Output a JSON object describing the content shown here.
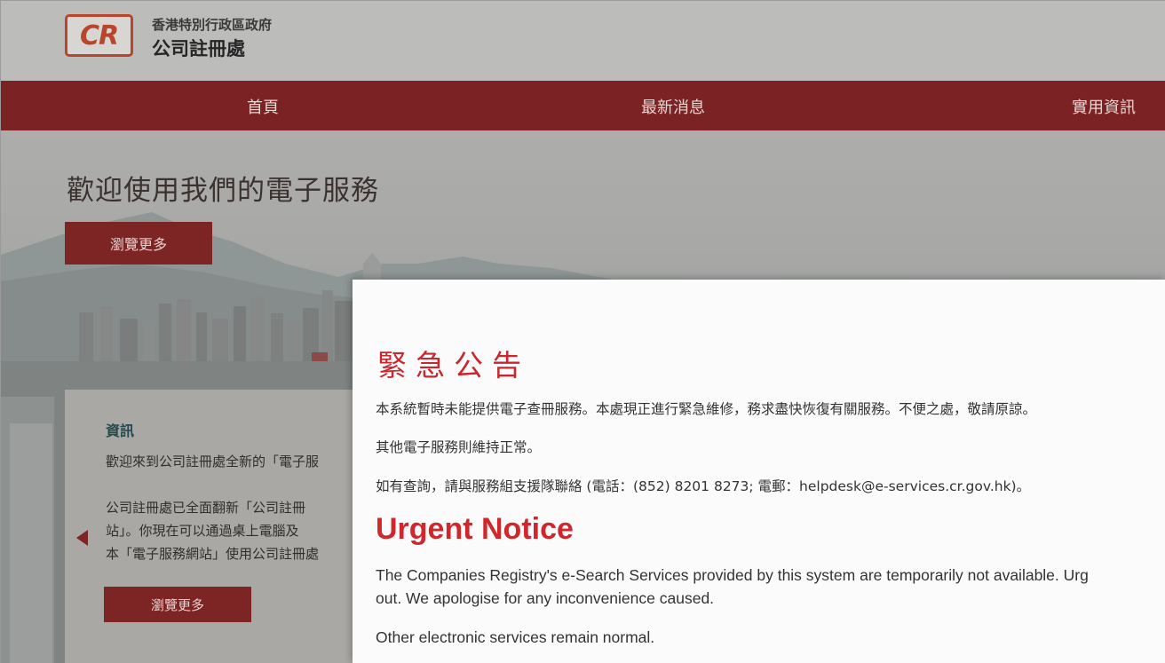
{
  "header": {
    "logo_text": "CR",
    "org_line1": "香港特別行政區政府",
    "org_line2": "公司註冊處"
  },
  "nav": {
    "items": [
      {
        "label": "首頁"
      },
      {
        "label": "最新消息"
      },
      {
        "label": "實用資訊"
      }
    ]
  },
  "hero": {
    "title": "歡迎使用我們的電子服務",
    "button_label": "瀏覽更多"
  },
  "info_card": {
    "heading": "資訊",
    "p1": "歡迎來到公司註冊處全新的「電子服",
    "p2_line1": "公司註冊處已全面翻新「公司註冊",
    "p2_line2": "站」。你現在可以通過桌上電腦及",
    "p2_line3": "本「電子服務網站」使用公司註冊處",
    "button_label": "瀏覽更多"
  },
  "modal": {
    "title_zh": "緊急公告",
    "zh_line1": "本系統暫時未能提供電子查冊服務。本處現正進行緊急維修，務求盡快恢復有關服務。不便之處，敬請原諒。",
    "zh_line2": "其他電子服務則維持正常。",
    "zh_line3": "如有查詢，請與服務組支援隊聯絡 (電話：(852) 8201 8273; 電郵：helpdesk@e-services.cr.gov.hk)。",
    "title_en": "Urgent Notice",
    "en_line1": "The Companies Registry's e-Search Services provided by this system are temporarily not available. Urg",
    "en_line2": "out. We apologise for any inconvenience caused.",
    "en_line3": "Other electronic services remain normal."
  },
  "colors": {
    "brand_red": "#7a2224",
    "notice_red": "#c8272d"
  }
}
